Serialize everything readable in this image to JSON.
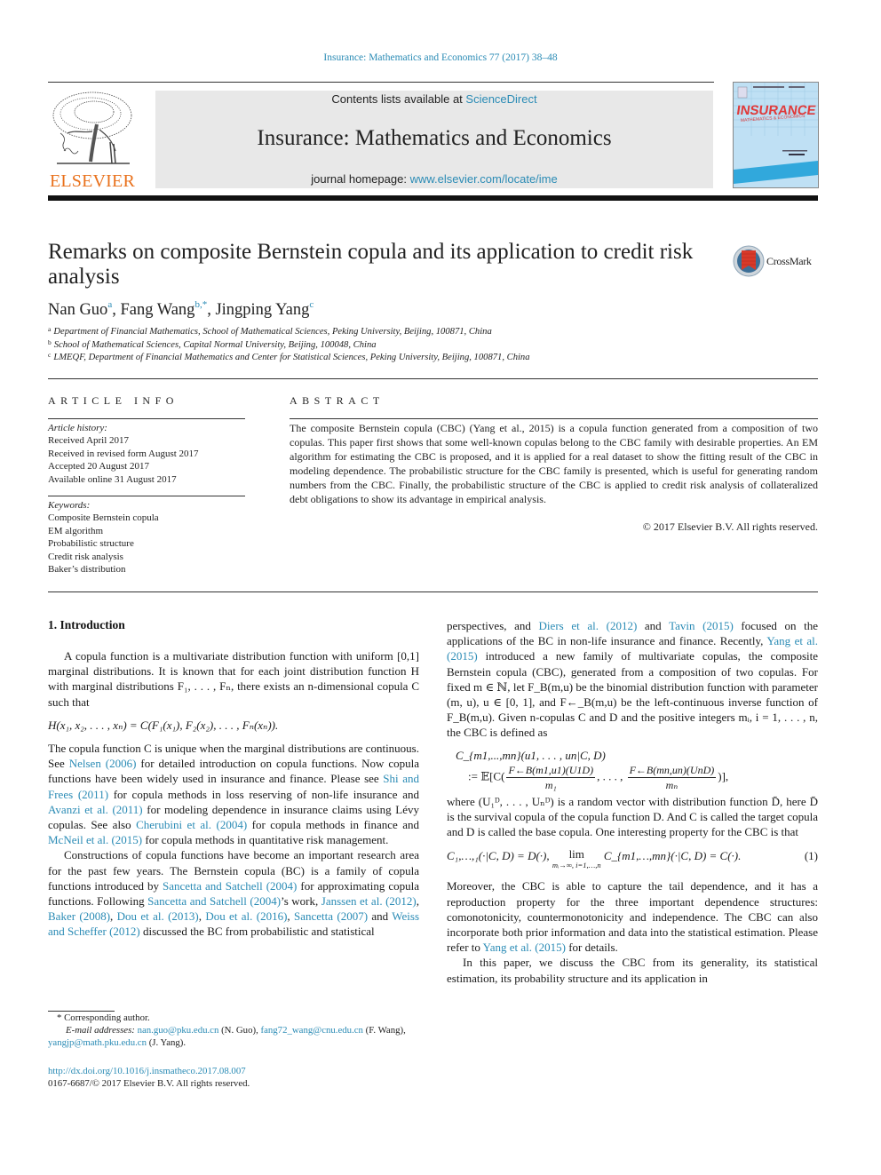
{
  "running_head": "Insurance: Mathematics and Economics 77 (2017) 38–48",
  "masthead": {
    "publisher_logo_text": "ELSEVIER",
    "contents_prefix": "Contents lists available at ",
    "contents_link": "ScienceDirect",
    "journal_name": "Insurance: Mathematics and Economics",
    "homepage_prefix": "journal homepage: ",
    "homepage_link": "www.elsevier.com/locate/ime",
    "cover_title": "INSURANCE",
    "cover_subtitle": "MATHEMATICS & ECONOMICS"
  },
  "article": {
    "title": "Remarks on composite Bernstein copula and its application to credit risk analysis",
    "crossmark_label": "CrossMark",
    "authors": [
      {
        "name": "Nan Guo",
        "sup": "a",
        "sep": ", "
      },
      {
        "name": "Fang Wang",
        "sup": "b,*",
        "sep": ", "
      },
      {
        "name": "Jingping Yang",
        "sup": "c",
        "sep": ""
      }
    ],
    "affiliations": [
      {
        "mark": "a",
        "text": "Department of Financial Mathematics, School of Mathematical Sciences, Peking University, Beijing, 100871, China"
      },
      {
        "mark": "b",
        "text": "School of Mathematical Sciences, Capital Normal University, Beijing, 100048, China"
      },
      {
        "mark": "c",
        "text": "LMEQF, Department of Financial Mathematics and Center for Statistical Sciences, Peking University, Beijing, 100871, China"
      }
    ]
  },
  "article_info": {
    "heading": "ARTICLE INFO",
    "history_label": "Article history:",
    "history": [
      "Received April 2017",
      "Received in revised form August 2017",
      "Accepted 20 August 2017",
      "Available online 31 August 2017"
    ],
    "keywords_label": "Keywords:",
    "keywords": [
      "Composite Bernstein copula",
      "EM algorithm",
      "Probabilistic structure",
      "Credit risk analysis",
      "Baker’s distribution"
    ]
  },
  "abstract": {
    "heading": "ABSTRACT",
    "text": "The composite Bernstein copula (CBC) (Yang et al., 2015) is a copula function generated from a composition of two copulas. This paper first shows that some well-known copulas belong to the CBC family with desirable properties. An EM algorithm for estimating the CBC is proposed, and it is applied for a real dataset to show the fitting result of the CBC in modeling dependence. The probabilistic structure for the CBC family is presented, which is useful for generating random numbers from the CBC. Finally, the probabilistic structure of the CBC is applied to credit risk analysis of collateralized debt obligations to show its advantage in empirical analysis.",
    "copyright": "© 2017 Elsevier B.V. All rights reserved."
  },
  "body": {
    "section_heading": "1.  Introduction",
    "p1": "A copula function is a multivariate distribution function with uniform [0,1] marginal distributions. It is known that for each joint distribution function H with marginal distributions F₁, . . . , Fₙ, there exists an n-dimensional copula C such that",
    "eq_sklar": "H(x₁, x₂, . . . , xₙ) = C(F₁(x₁), F₂(x₂), . . . , Fₙ(xₙ)).",
    "p2_parts": [
      {
        "t": "The copula function C is unique when the marginal distributions are continuous. See ",
        "link": false
      },
      {
        "t": "Nelsen (2006)",
        "link": true
      },
      {
        "t": " for detailed introduction on copula functions. Now copula functions have been widely used in insurance and finance. Please see ",
        "link": false
      },
      {
        "t": "Shi and Frees (2011)",
        "link": true
      },
      {
        "t": " for copula methods in loss reserving of non-life insurance and ",
        "link": false
      },
      {
        "t": "Avanzi et al. (2011)",
        "link": true
      },
      {
        "t": " for modeling dependence in insurance claims using Lévy copulas. See also ",
        "link": false
      },
      {
        "t": "Cherubini et al. (2004)",
        "link": true
      },
      {
        "t": " for copula methods in finance and ",
        "link": false
      },
      {
        "t": "McNeil et al. (2015)",
        "link": true
      },
      {
        "t": " for copula methods in quantitative risk management.",
        "link": false
      }
    ],
    "p3_parts": [
      {
        "t": "Constructions of copula functions have become an important research area for the past few years. The Bernstein copula (BC) is a family of copula functions introduced by ",
        "link": false
      },
      {
        "t": "Sancetta and Satchell (2004)",
        "link": true
      },
      {
        "t": " for approximating copula functions. Following ",
        "link": false
      },
      {
        "t": "Sancetta and Satchell (2004)",
        "link": true
      },
      {
        "t": "’s work, ",
        "link": false
      },
      {
        "t": "Janssen et al. (2012)",
        "link": true
      },
      {
        "t": ", ",
        "link": false
      },
      {
        "t": "Baker (2008)",
        "link": true
      },
      {
        "t": ", ",
        "link": false
      },
      {
        "t": "Dou et al. (2013)",
        "link": true
      },
      {
        "t": ", ",
        "link": false
      },
      {
        "t": "Dou et al. (2016)",
        "link": true
      },
      {
        "t": ", ",
        "link": false
      },
      {
        "t": "Sancetta (2007)",
        "link": true
      },
      {
        "t": " and ",
        "link": false
      },
      {
        "t": "Weiss and Scheffer (2012)",
        "link": true
      },
      {
        "t": " discussed the BC from probabilistic and statistical perspectives, and ",
        "link": false
      },
      {
        "t": "Diers et al. (2012)",
        "link": true
      },
      {
        "t": " and ",
        "link": false
      },
      {
        "t": "Tavin (2015)",
        "link": true
      },
      {
        "t": " focused on the applications of the BC in non-life insurance and finance. Recently, ",
        "link": false
      },
      {
        "t": "Yang et al. (2015)",
        "link": true
      },
      {
        "t": " introduced a new family of multivariate copulas, the composite Bernstein copula (CBC), generated from a composition of two copulas. For fixed m ∈ ℕ, let F_B(m,u) be the binomial distribution function with parameter (m, u), u ∈ [0, 1], and F←_B(m,u) be the left-continuous inverse function of F_B(m,u). Given n-copulas C and D and the positive integers mᵢ, i = 1, . . . , n, the CBC is defined as",
        "link": false
      }
    ],
    "eq_cbc_line1": "C_{m1,...,mn}(u1, . . . , un|C, D)",
    "eq_cbc_line2_prefix": ":= 𝔼[C(",
    "eq_cbc_frac1_num": "F←B(m1,u1)(U1D)",
    "eq_cbc_frac1_den": "m₁",
    "eq_cbc_mid": ", . . . , ",
    "eq_cbc_frac2_num": "F←B(mn,un)(UnD)",
    "eq_cbc_frac2_den": "mₙ",
    "eq_cbc_suffix": ")],",
    "p4": "where (U₁ᴰ, . . . , Uₙᴰ) is a random vector with distribution function D̄, here D̄ is the survival copula of the copula function D. And C is called the target copula and D is called the base copula. One interesting property for the CBC is that",
    "eq1_left": "C₁,…,₁(·|C, D) = D(·),",
    "eq1_lim": "lim",
    "eq1_lim_sub": "mᵢ→∞, i=1,…,n",
    "eq1_right": "C_{m1,…,mn}(·|C, D) = C(·).",
    "eq1_number": "(1)",
    "p5_parts": [
      {
        "t": "Moreover, the CBC is able to capture the tail dependence, and it has a reproduction property for the three important dependence structures: comonotonicity, countermonotonicity and independence. The CBC can also incorporate both prior information and data into the statistical estimation. Please refer to ",
        "link": false
      },
      {
        "t": "Yang et al. (2015)",
        "link": true
      },
      {
        "t": " for details.",
        "link": false
      }
    ],
    "p6": "In this paper, we discuss the CBC from its generality, its statistical estimation, its probability structure and its application in"
  },
  "footnotes": {
    "corresponding": "Corresponding author.",
    "email_label": "E-mail addresses: ",
    "emails": [
      {
        "addr": "nan.guo@pku.edu.cn",
        "who": " (N. Guo), "
      },
      {
        "addr": "fang72_wang@cnu.edu.cn",
        "who": " (F. Wang), "
      },
      {
        "addr": "yangjp@math.pku.edu.cn",
        "who": " (J. Yang)."
      }
    ],
    "doi": "http://dx.doi.org/10.1016/j.insmatheco.2017.08.007",
    "issn_rights": "0167-6687/© 2017 Elsevier B.V. All rights reserved."
  },
  "colors": {
    "link": "#2a8bb5",
    "elsevier_orange": "#e9711c",
    "masthead_bg": "#e8e8e8",
    "cover_bg": "#bfe0f4",
    "cover_title_red": "#e03a3a"
  }
}
